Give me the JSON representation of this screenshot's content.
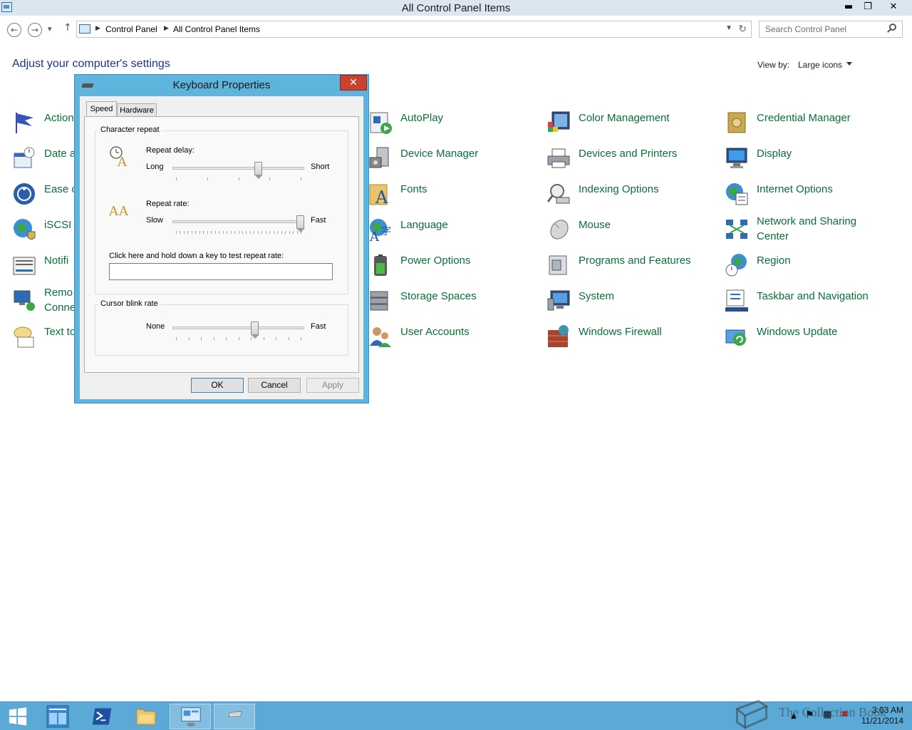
{
  "window": {
    "title": "All Control Panel Items",
    "minimize": "▬",
    "restore": "❐",
    "close": "✕"
  },
  "nav": {
    "back": "←",
    "forward": "→",
    "recent": "▾",
    "up": "↑",
    "breadcrumb": [
      "Control Panel",
      "All Control Panel Items"
    ],
    "search_placeholder": "Search Control Panel"
  },
  "page": {
    "heading": "Adjust your computer's settings",
    "view_by_label": "View by:",
    "view_by_value": "Large icons"
  },
  "items": {
    "action_center": "Action",
    "date_time": "Date a",
    "ease_of_access": "Ease o",
    "iscsi": "iSCSI I",
    "notification": "Notifi",
    "remote_connections": "Remo\nConne",
    "text_to_speech": "Text to",
    "autoplay": "AutoPlay",
    "device_manager": "Device Manager",
    "fonts": "Fonts",
    "language": "Language",
    "power_options": "Power Options",
    "storage_spaces": "Storage Spaces",
    "user_accounts": "User Accounts",
    "color_management": "Color Management",
    "devices_printers": "Devices and Printers",
    "indexing_options": "Indexing Options",
    "mouse": "Mouse",
    "programs_features": "Programs and Features",
    "system": "System",
    "windows_firewall": "Windows Firewall",
    "credential_manager": "Credential Manager",
    "display": "Display",
    "internet_options": "Internet Options",
    "network_sharing": "Network and Sharing Center",
    "region": "Region",
    "taskbar_navigation": "Taskbar and Navigation",
    "windows_update": "Windows Update"
  },
  "dialog": {
    "title": "Keyboard Properties",
    "close": "✕",
    "tabs": {
      "speed": "Speed",
      "hardware": "Hardware"
    },
    "char_repeat": {
      "group": "Character repeat",
      "delay_label": "Repeat delay:",
      "delay_min": "Long",
      "delay_max": "Short",
      "delay_level": 0.66,
      "rate_label": "Repeat rate:",
      "rate_min": "Slow",
      "rate_max": "Fast",
      "rate_level": 1.0,
      "test_label": "Click here and hold down a key to test repeat rate:"
    },
    "cursor": {
      "group": "Cursor blink rate",
      "min": "None",
      "max": "Fast",
      "level": 0.63
    },
    "buttons": {
      "ok": "OK",
      "cancel": "Cancel",
      "apply": "Apply"
    }
  },
  "taskbar": {
    "time": "3:03 AM",
    "date": "11/21/2014",
    "watermark": "The Collection Book"
  },
  "colors": {
    "link": "#0b6e38",
    "heading": "#1e3287",
    "dialog_frame": "#5fb4dd",
    "taskbar": "#5aa9d6"
  }
}
